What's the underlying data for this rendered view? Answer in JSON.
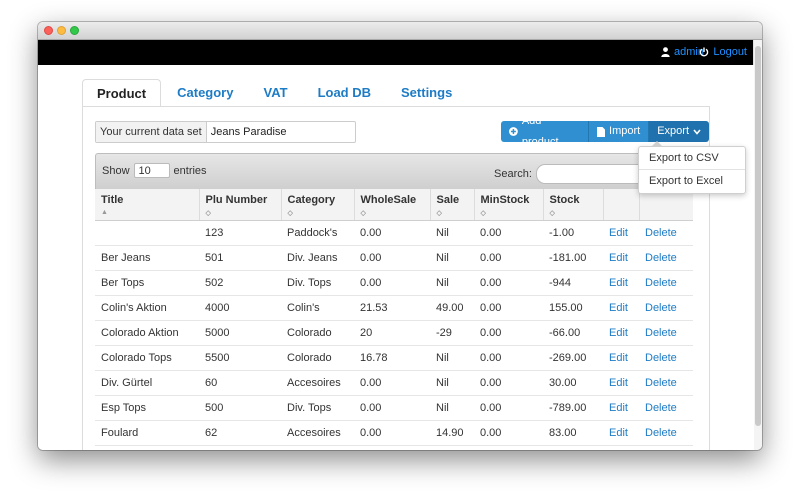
{
  "nav": {
    "user": "admin",
    "logout": "Logout"
  },
  "tabs": [
    "Product",
    "Category",
    "VAT",
    "Load DB",
    "Settings"
  ],
  "dataset": {
    "label": "Your current data set",
    "value": "Jeans Paradise"
  },
  "buttons": {
    "add": "Add product",
    "import": "Import",
    "export": "Export"
  },
  "export_menu": [
    "Export to CSV",
    "Export to Excel"
  ],
  "table": {
    "show_label": "Show",
    "show_value": "10",
    "entries_label": "entries",
    "search_label": "Search:",
    "columns": [
      "Title",
      "Plu Number",
      "Category",
      "WholeSale",
      "Sale",
      "MinStock",
      "Stock",
      "",
      ""
    ],
    "edit_label": "Edit",
    "delete_label": "Delete",
    "rows": [
      [
        "",
        "123",
        "Paddock's",
        "0.00",
        "Nil",
        "0.00",
        "-1.00"
      ],
      [
        "Ber Jeans",
        "501",
        "Div. Jeans",
        "0.00",
        "Nil",
        "0.00",
        "-181.00"
      ],
      [
        "Ber Tops",
        "502",
        "Div. Tops",
        "0.00",
        "Nil",
        "0.00",
        "-944"
      ],
      [
        "Colin's Aktion",
        "4000",
        "Colin's",
        "21.53",
        "49.00",
        "0.00",
        "155.00"
      ],
      [
        "Colorado Aktion",
        "5000",
        "Colorado",
        "20",
        "-29",
        "0.00",
        "-66.00"
      ],
      [
        "Colorado Tops",
        "5500",
        "Colorado",
        "16.78",
        "Nil",
        "0.00",
        "-269.00"
      ],
      [
        "Div. Gürtel",
        "60",
        "Accesoires",
        "0.00",
        "Nil",
        "0.00",
        "30.00"
      ],
      [
        "Esp Tops",
        "500",
        "Div. Tops",
        "0.00",
        "Nil",
        "0.00",
        "-789.00"
      ],
      [
        "Foulard",
        "62",
        "Accesoires",
        "0.00",
        "14.90",
        "0.00",
        "83.00"
      ]
    ]
  }
}
